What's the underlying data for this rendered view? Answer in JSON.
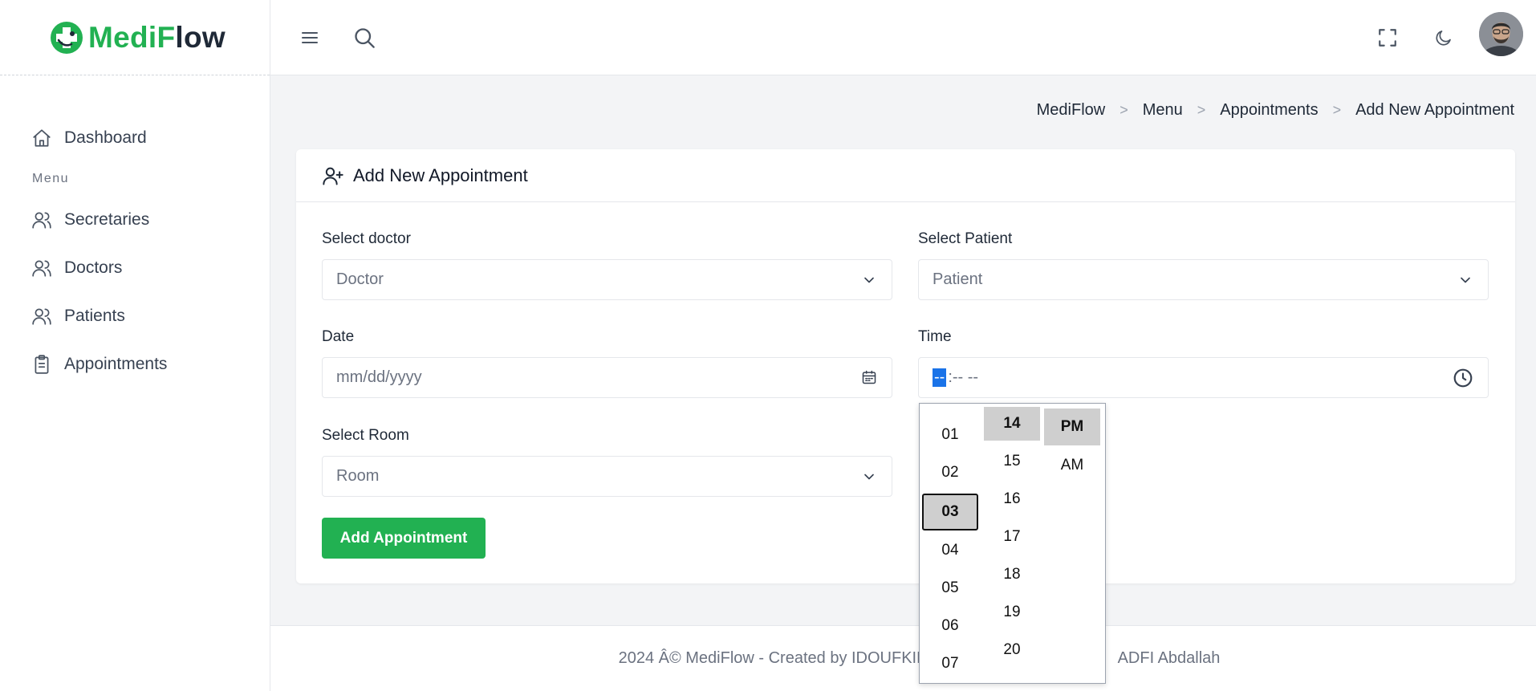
{
  "app": {
    "logo_part1": "Medi",
    "logo_part2": "F",
    "logo_part3": "low"
  },
  "sidebar": {
    "items": [
      {
        "label": "Dashboard",
        "icon": "home-icon"
      },
      {
        "label": "Secretaries",
        "icon": "users-icon"
      },
      {
        "label": "Doctors",
        "icon": "users-icon"
      },
      {
        "label": "Patients",
        "icon": "users-icon"
      },
      {
        "label": "Appointments",
        "icon": "clipboard-icon"
      }
    ],
    "section_label": "Menu"
  },
  "topbar": {
    "icons": [
      "menu-icon",
      "search-icon",
      "fullscreen-icon",
      "moon-icon",
      "avatar"
    ]
  },
  "breadcrumb": [
    "MediFlow",
    "Menu",
    "Appointments",
    "Add New Appointment"
  ],
  "card": {
    "title": "Add New Appointment",
    "doctor_label": "Select doctor",
    "doctor_value": "Doctor",
    "patient_label": "Select Patient",
    "patient_value": "Patient",
    "date_label": "Date",
    "date_placeholder": "mm/dd/yyyy",
    "time_label": "Time",
    "time_seg_hour": "--",
    "time_seg_rest": ":-- --",
    "room_label": "Select Room",
    "room_value": "Room",
    "submit_label": "Add Appointment"
  },
  "time_picker": {
    "hours": [
      "01",
      "02",
      "03",
      "04",
      "05",
      "06",
      "07"
    ],
    "selected_hour": "03",
    "minutes": [
      "14",
      "15",
      "16",
      "17",
      "18",
      "19",
      "20"
    ],
    "selected_minute": "14",
    "periods": [
      "PM",
      "AM"
    ],
    "selected_period": "PM"
  },
  "footer": {
    "text": "2024 Â© MediFlow - Created by IDOUFKIR",
    "text_right": "ADFI Abdallah"
  },
  "colors": {
    "brand_green": "#22b152",
    "selection_blue": "#1a73e8"
  }
}
